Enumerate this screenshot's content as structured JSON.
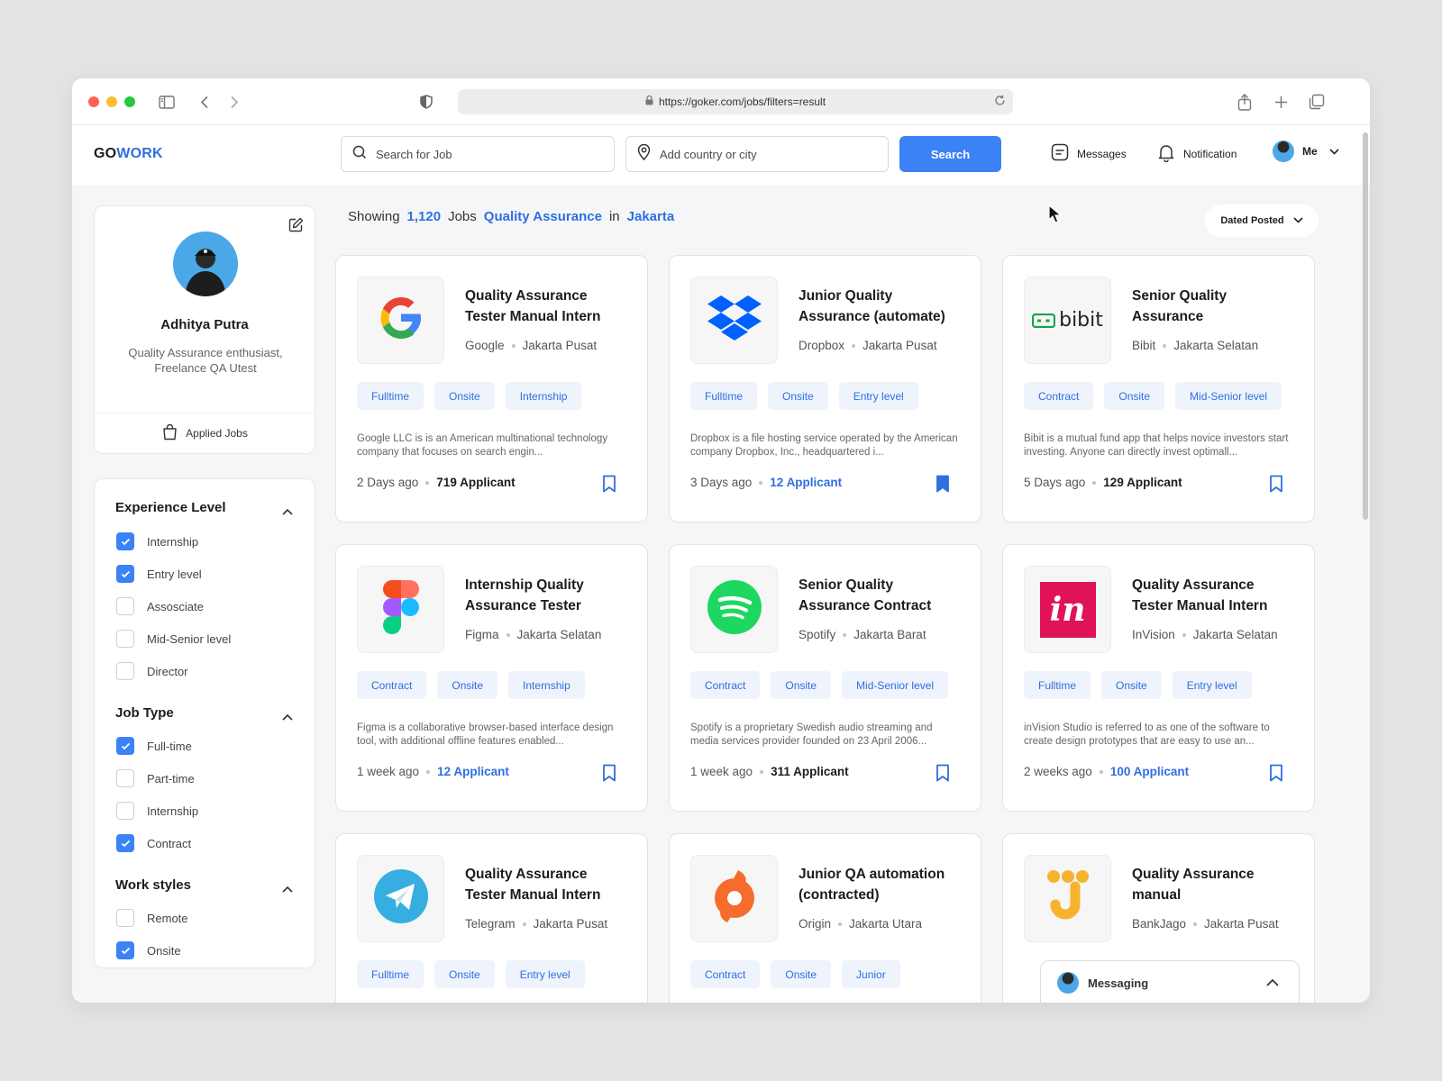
{
  "browser": {
    "url": "https://goker.com/jobs/filters=result"
  },
  "header": {
    "logo_go": "GO",
    "logo_work": "WORK",
    "search_placeholder": "Search for Job",
    "location_placeholder": "Add country or city",
    "search_button": "Search",
    "messages_label": "Messages",
    "notification_label": "Notification",
    "me_label": "Me"
  },
  "profile": {
    "name": "Adhitya Putra",
    "bio": "Quality Assurance enthusiast, Freelance QA Utest",
    "applied_jobs": "Applied Jobs"
  },
  "filters": {
    "experience": {
      "title": "Experience Level",
      "options": [
        {
          "label": "Internship",
          "checked": true
        },
        {
          "label": "Entry level",
          "checked": true
        },
        {
          "label": "Assosciate",
          "checked": false
        },
        {
          "label": "Mid-Senior level",
          "checked": false
        },
        {
          "label": "Director",
          "checked": false
        }
      ]
    },
    "job_type": {
      "title": "Job Type",
      "options": [
        {
          "label": "Full-time",
          "checked": true
        },
        {
          "label": "Part-time",
          "checked": false
        },
        {
          "label": "Internship",
          "checked": false
        },
        {
          "label": "Contract",
          "checked": true
        }
      ]
    },
    "work_styles": {
      "title": "Work styles",
      "options": [
        {
          "label": "Remote",
          "checked": false
        },
        {
          "label": "Onsite",
          "checked": true
        }
      ]
    }
  },
  "results": {
    "showing": "Showing",
    "count": "1,120",
    "jobs": "Jobs",
    "query": "Quality Assurance",
    "in": "in",
    "location": "Jakarta",
    "sort_label": "Dated Posted"
  },
  "jobs": [
    {
      "title": "Quality Assurance Tester Manual Intern",
      "company": "Google",
      "location": "Jakarta Pusat",
      "tags": [
        "Fulltime",
        "Onsite",
        "Internship"
      ],
      "description": "Google LLC is is an American multinational technology company that focuses on search engin...",
      "posted": "2 Days ago",
      "applicants": "719 Applicant",
      "applicants_highlight": false,
      "saved": false,
      "logo": "google-logo"
    },
    {
      "title": "Junior Quality Assurance (automate)",
      "company": "Dropbox",
      "location": "Jakarta Pusat",
      "tags": [
        "Fulltime",
        "Onsite",
        "Entry level"
      ],
      "description": "Dropbox is a file hosting service operated by the American company Dropbox, Inc., headquartered i...",
      "posted": "3 Days ago",
      "applicants": "12 Applicant",
      "applicants_highlight": true,
      "saved": true,
      "logo": "dropbox-logo"
    },
    {
      "title": "Senior Quality Assurance",
      "company": "Bibit",
      "location": "Jakarta Selatan",
      "tags": [
        "Contract",
        "Onsite",
        "Mid-Senior level"
      ],
      "description": "Bibit is a mutual fund app that helps novice investors start investing. Anyone can directly invest optimall...",
      "posted": "5 Days ago",
      "applicants": "129 Applicant",
      "applicants_highlight": false,
      "saved": false,
      "logo": "bibit-logo",
      "logo_text": "bibit"
    },
    {
      "title": "Internship Quality Assurance  Tester",
      "company": "Figma",
      "location": "Jakarta Selatan",
      "tags": [
        "Contract",
        "Onsite",
        "Internship"
      ],
      "description": "Figma is a collaborative browser-based interface design tool, with additional offline features enabled...",
      "posted": "1 week ago",
      "applicants": "12 Applicant",
      "applicants_highlight": true,
      "saved": false,
      "logo": "figma-logo"
    },
    {
      "title": "Senior Quality Assurance Contract",
      "company": "Spotify",
      "location": "Jakarta Barat",
      "tags": [
        "Contract",
        "Onsite",
        "Mid-Senior level"
      ],
      "description": "Spotify is a proprietary Swedish audio streaming and media services provider founded on 23 April 2006...",
      "posted": "1 week ago",
      "applicants": "311 Applicant",
      "applicants_highlight": false,
      "saved": false,
      "logo": "spotify-logo"
    },
    {
      "title": "Quality Assurance Tester Manual Intern",
      "company": "InVision",
      "location": "Jakarta Selatan",
      "tags": [
        "Fulltime",
        "Onsite",
        "Entry level"
      ],
      "description": "inVision Studio is referred to as one of the software to create design prototypes that are easy to use an...",
      "posted": "2 weeks ago",
      "applicants": "100 Applicant",
      "applicants_highlight": true,
      "saved": false,
      "logo": "invision-logo",
      "logo_text": "in"
    },
    {
      "title": "Quality Assurance Tester Manual Intern",
      "company": "Telegram",
      "location": "Jakarta Pusat",
      "tags": [
        "Fulltime",
        "Onsite",
        "Entry level"
      ],
      "description": "",
      "posted": "",
      "applicants": "",
      "applicants_highlight": false,
      "saved": false,
      "logo": "telegram-logo"
    },
    {
      "title": "Junior QA automation (contracted)",
      "company": "Origin",
      "location": "Jakarta Utara",
      "tags": [
        "Contract",
        "Onsite",
        "Junior"
      ],
      "description": "",
      "posted": "",
      "applicants": "",
      "applicants_highlight": false,
      "saved": false,
      "logo": "origin-logo"
    },
    {
      "title": "Quality Assurance manual",
      "company": "BankJago",
      "location": "Jakarta Pusat",
      "tags": [],
      "description": "",
      "posted": "",
      "applicants": "",
      "applicants_highlight": false,
      "saved": false,
      "logo": "bankjago-logo"
    }
  ],
  "messaging": {
    "label": "Messaging"
  },
  "colors": {
    "accent": "#3b82f6",
    "link": "#2f6fe0",
    "tag_bg": "#eef3fc"
  }
}
